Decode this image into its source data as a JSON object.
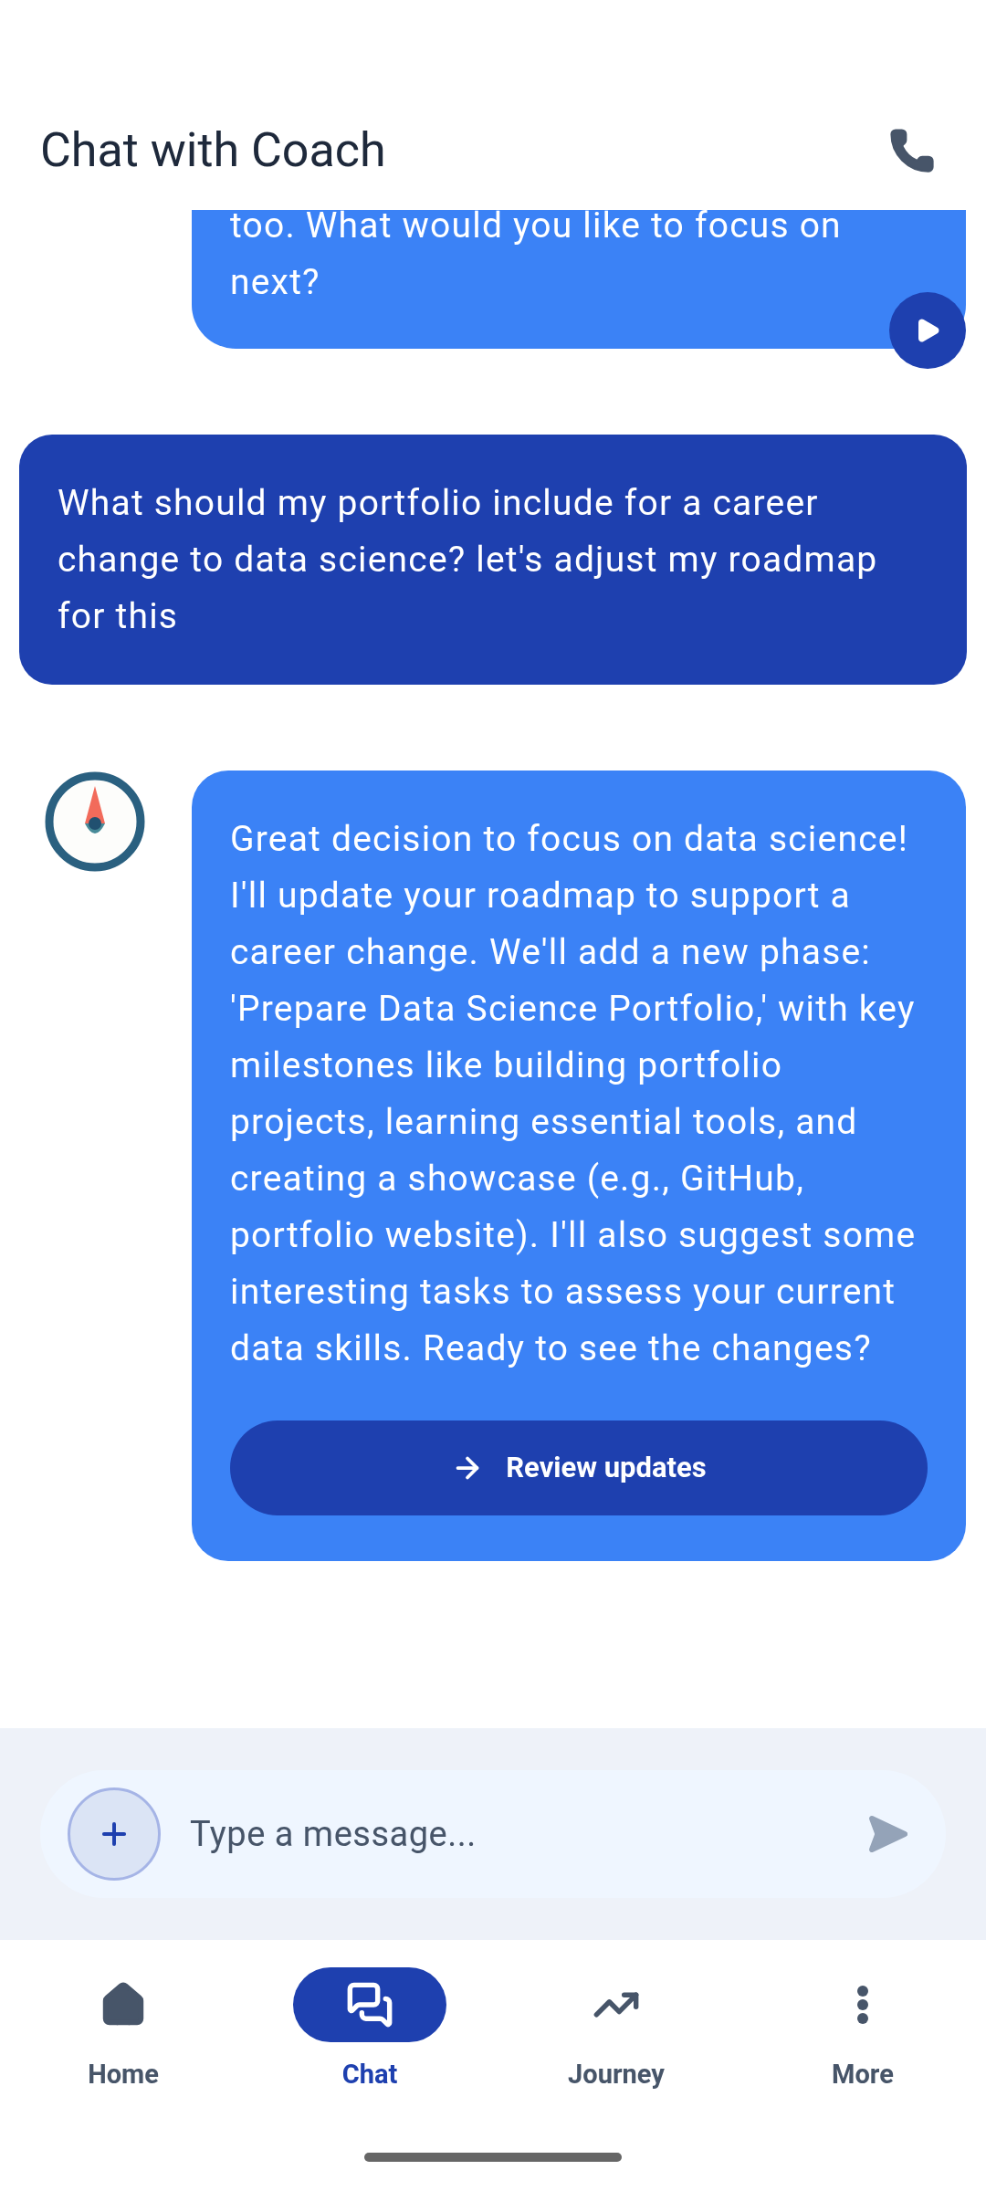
{
  "header": {
    "title": "Chat with Coach"
  },
  "messages": [
    {
      "kind": "coach_tail",
      "lines": [
        "too. What would you like to focus on",
        "next?"
      ]
    },
    {
      "kind": "user",
      "text": "What should my portfolio include for a career change to data science? let's adjust my roadmap for this"
    },
    {
      "kind": "coach",
      "text": "Great decision to focus on data science! I'll update your roadmap to support a career change. We'll add a new phase: 'Prepare Data Science Portfolio,' with key milestones like building portfolio projects, learning essential tools, and creating a showcase (e.g., GitHub, portfolio website). I'll also suggest some interesting tasks to assess your current data skills. Ready to see the changes?",
      "action": "Review updates"
    }
  ],
  "composer": {
    "placeholder": "Type a message..."
  },
  "nav": [
    {
      "kind": "home",
      "label": "Home",
      "selected": false
    },
    {
      "kind": "chat",
      "label": "Chat",
      "selected": true
    },
    {
      "kind": "journey",
      "label": "Journey",
      "selected": false
    },
    {
      "kind": "more",
      "label": "More",
      "selected": false
    }
  ]
}
